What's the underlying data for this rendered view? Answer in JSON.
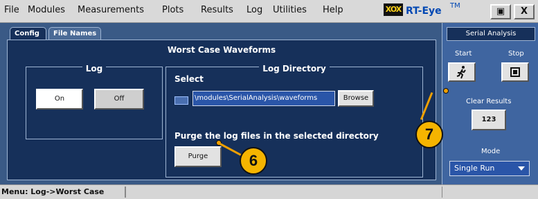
{
  "menu": [
    "File",
    "Modules",
    "Measurements",
    "Plots",
    "Results",
    "Log",
    "Utilities",
    "Help"
  ],
  "app": {
    "logo": "XOX",
    "name": "RT-Eye",
    "tm": "TM"
  },
  "window_buttons": {
    "restore": "▣",
    "close": "X"
  },
  "tabs": [
    "Config",
    "File Names"
  ],
  "section_title": "Worst Case Waveforms",
  "log_group": {
    "title": "Log",
    "on": "On",
    "off": "Off"
  },
  "dir_group": {
    "title": "Log Directory",
    "select_label": "Select",
    "path_value": "\\modules\\SerialAnalysis\\waveforms",
    "browse": "Browse",
    "purge_label": "Purge the log files in the selected directory",
    "purge": "Purge"
  },
  "right_panel": {
    "header": "Serial Analysis",
    "start": "Start",
    "stop": "Stop",
    "clear_results": "Clear Results",
    "clear_icon_text": "123",
    "mode_label": "Mode",
    "mode_value": "Single Run"
  },
  "status": {
    "text": "Menu: Log->Worst Case"
  },
  "callouts": [
    "6",
    "7"
  ],
  "colors": {
    "panel": "#16305a",
    "accent": "#f5b400",
    "field": "#2a55a8"
  }
}
